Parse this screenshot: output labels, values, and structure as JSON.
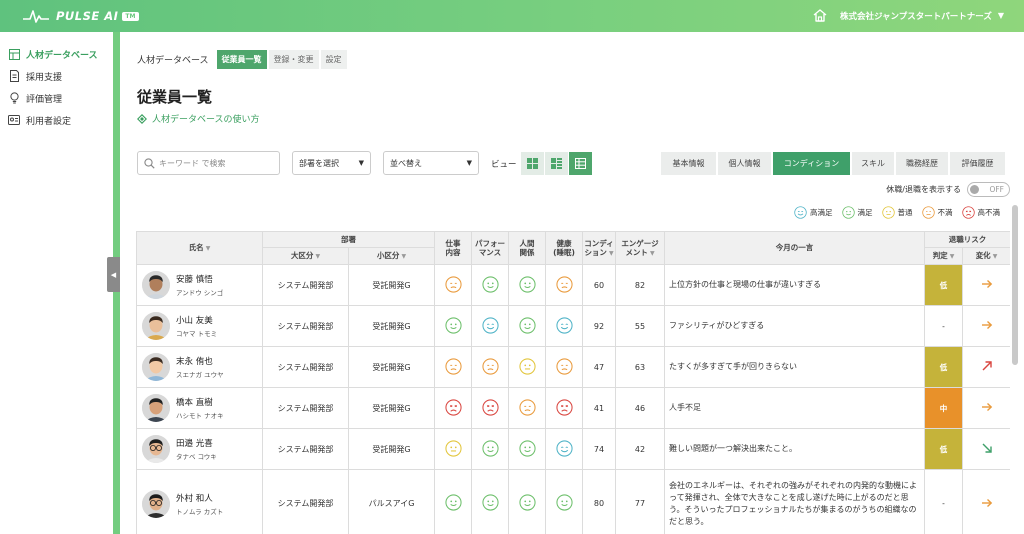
{
  "app": {
    "logo_text": "PULSE AI",
    "logo_badge": "TM",
    "company": "株式会社ジャンプスタートパートナーズ"
  },
  "sidebar": {
    "items": [
      {
        "label": "人材データベース",
        "icon": "database-icon",
        "active": true
      },
      {
        "label": "採用支援",
        "icon": "document-icon",
        "active": false
      },
      {
        "label": "評価管理",
        "icon": "lightbulb-icon",
        "active": false
      },
      {
        "label": "利用者設定",
        "icon": "id-card-icon",
        "active": false
      }
    ]
  },
  "breadcrumb": {
    "label": "人材データベース",
    "tabs": [
      "従業員一覧",
      "登録・変更",
      "設定"
    ]
  },
  "page": {
    "title": "従業員一覧",
    "help_link": "人材データベースの使い方"
  },
  "filters": {
    "search_placeholder": "キーワード で検索",
    "dept_select": "部署を選択",
    "sort_select": "並べ替え",
    "view_label": "ビュー"
  },
  "category_tabs": [
    "基本情報",
    "個人情報",
    "コンディション",
    "スキル",
    "職務経歴",
    "評価履歴"
  ],
  "toggle": {
    "label": "休職/退職を表示する",
    "state": "OFF"
  },
  "legend": [
    {
      "label": "高満足",
      "level": "very_satisfied",
      "color": "#4fb3c7"
    },
    {
      "label": "満足",
      "level": "satisfied",
      "color": "#6cbf6a"
    },
    {
      "label": "普通",
      "level": "neutral",
      "color": "#e2c53a"
    },
    {
      "label": "不満",
      "level": "dissatisfied",
      "color": "#e99a3c"
    },
    {
      "label": "高不満",
      "level": "very_dissatisfied",
      "color": "#d9453f"
    }
  ],
  "table": {
    "headers": {
      "name": "氏名",
      "department": "部署",
      "major": "大区分",
      "minor": "小区分",
      "work": [
        "仕事",
        "内容"
      ],
      "performance": [
        "パフォー",
        "マンス"
      ],
      "relations": [
        "人間",
        "関係"
      ],
      "health": [
        "健康",
        "(睡眠)"
      ],
      "condition": [
        "コンディ",
        "ション"
      ],
      "engagement": [
        "エンゲージ",
        "メント"
      ],
      "comment": "今月の一言",
      "risk": "退職リスク",
      "judge": "判定",
      "change": "変化"
    },
    "rows": [
      {
        "name": "安藤 慎悟",
        "kana": "アンドウ シンゴ",
        "major": "システム開発部",
        "minor": "受託開発G",
        "work": "dissatisfied",
        "perf": "satisfied",
        "rel": "satisfied",
        "health": "dissatisfied",
        "condition": "60",
        "engagement": "82",
        "comment": "上位方針の仕事と現場の仕事が違いすぎる",
        "judge": "低",
        "judge_level": "low",
        "change": "flat",
        "avatar": {
          "skin": "#b07f5c",
          "hair": "#2a2a2a",
          "glasses": false,
          "shirt": "#cfd6dd"
        }
      },
      {
        "name": "小山 友美",
        "kana": "コヤマ トモミ",
        "major": "システム開発部",
        "minor": "受託開発G",
        "work": "satisfied",
        "perf": "very_satisfied",
        "rel": "satisfied",
        "health": "very_satisfied",
        "condition": "92",
        "engagement": "55",
        "comment": "ファシリティがひどすぎる",
        "judge": "-",
        "judge_level": "none",
        "change": "flat",
        "avatar": {
          "skin": "#e9bf9a",
          "hair": "#3a2a1f",
          "glasses": false,
          "shirt": "#d9a94f"
        }
      },
      {
        "name": "末永 侑也",
        "kana": "スエナガ ユウヤ",
        "major": "システム開発部",
        "minor": "受託開発G",
        "work": "dissatisfied",
        "perf": "dissatisfied",
        "rel": "neutral",
        "health": "dissatisfied",
        "condition": "47",
        "engagement": "63",
        "comment": "たすくが多すぎて手が回りきらない",
        "judge": "低",
        "judge_level": "low",
        "change": "up",
        "avatar": {
          "skin": "#f1c9a5",
          "hair": "#3b2c22",
          "glasses": false,
          "shirt": "#8fb7d8"
        }
      },
      {
        "name": "橋本 直樹",
        "kana": "ハシモト ナオキ",
        "major": "システム開発部",
        "minor": "受託開発G",
        "work": "very_dissatisfied",
        "perf": "very_dissatisfied",
        "rel": "dissatisfied",
        "health": "very_dissatisfied",
        "condition": "41",
        "engagement": "46",
        "comment": "人手不足",
        "judge": "中",
        "judge_level": "mid",
        "change": "flat",
        "avatar": {
          "skin": "#d7a17a",
          "hair": "#222222",
          "glasses": false,
          "shirt": "#3d4652"
        }
      },
      {
        "name": "田邉 光喜",
        "kana": "タナベ コウキ",
        "major": "システム開発部",
        "minor": "受託開発G",
        "work": "neutral",
        "perf": "satisfied",
        "rel": "satisfied",
        "health": "very_satisfied",
        "condition": "74",
        "engagement": "42",
        "comment": "難しい問題が一つ解決出来たこと。",
        "judge": "低",
        "judge_level": "low",
        "change": "down",
        "avatar": {
          "skin": "#e6b792",
          "hair": "#1f1f1f",
          "glasses": true,
          "shirt": "#e9e9e9"
        }
      },
      {
        "name": "外村 和人",
        "kana": "トノムラ カズト",
        "major": "システム開発部",
        "minor": "パルスアイG",
        "work": "satisfied",
        "perf": "satisfied",
        "rel": "satisfied",
        "health": "satisfied",
        "condition": "80",
        "engagement": "77",
        "comment": "会社のエネルギーは、それぞれの強みがそれぞれの内発的な動機によって発揮され、全体で大きなことを成し遂げた時に上がるのだと思う。そういったプロフェッショナルたちが集まるのがうちの組織なのだと思う。",
        "judge": "-",
        "judge_level": "none",
        "change": "flat",
        "avatar": {
          "skin": "#e0b08a",
          "hair": "#1c1c1c",
          "glasses": true,
          "shirt": "#2e2e2e"
        }
      }
    ]
  }
}
